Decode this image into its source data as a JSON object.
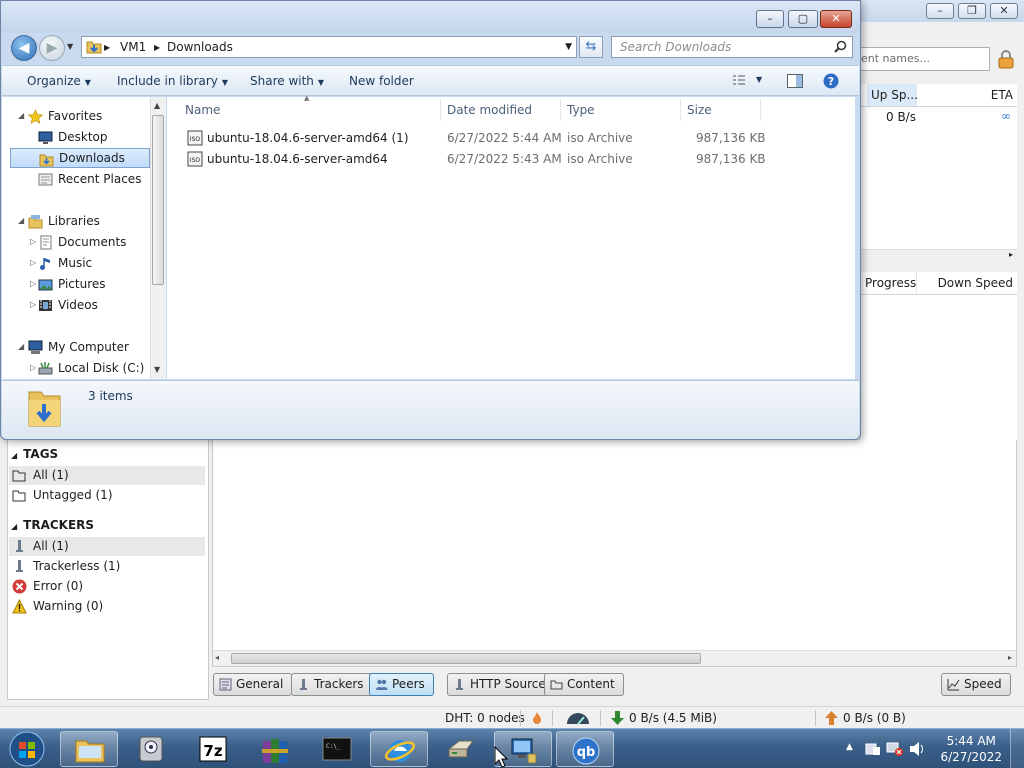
{
  "qbittorrent": {
    "search_placeholder": "ent names...",
    "torrent_columns": [
      "Up Sp...",
      "ETA"
    ],
    "torrent_row": {
      "up_speed": "0 B/s",
      "eta": "∞"
    },
    "peer_columns": [
      "Progress",
      "Down Speed"
    ],
    "sidebar": {
      "tags_title": "TAGS",
      "tags": [
        {
          "label": "All (1)",
          "icon": "folder-open-icon"
        },
        {
          "label": "Untagged (1)",
          "icon": "folder-open-icon"
        }
      ],
      "trackers_title": "TRACKERS",
      "trackers": [
        {
          "label": "All (1)",
          "icon": "tracker-icon"
        },
        {
          "label": "Trackerless (1)",
          "icon": "tracker-icon"
        },
        {
          "label": "Error (0)",
          "icon": "error-icon"
        },
        {
          "label": "Warning (0)",
          "icon": "warning-icon"
        }
      ]
    },
    "tabs": [
      {
        "label": "General",
        "icon": "info-icon"
      },
      {
        "label": "Trackers",
        "icon": "tracker-icon"
      },
      {
        "label": "Peers",
        "icon": "peers-icon"
      },
      {
        "label": "HTTP Sources",
        "icon": "server-icon"
      },
      {
        "label": "Content",
        "icon": "folder-icon"
      }
    ],
    "speed_button": "Speed",
    "status": {
      "dht": "DHT: 0 nodes",
      "down": "0 B/s (4.5 MiB)",
      "up": "0 B/s (0 B)"
    }
  },
  "explorer": {
    "breadcrumb": [
      "VM1",
      "Downloads"
    ],
    "search_placeholder": "Search Downloads",
    "toolbar": {
      "organize": "Organize",
      "include": "Include in library",
      "share": "Share with",
      "newfolder": "New folder"
    },
    "nav": {
      "favorites": "Favorites",
      "desktop": "Desktop",
      "downloads": "Downloads",
      "recent": "Recent Places",
      "libraries": "Libraries",
      "documents": "Documents",
      "music": "Music",
      "pictures": "Pictures",
      "videos": "Videos",
      "computer": "My Computer",
      "localdisk": "Local Disk (C:)"
    },
    "columns": {
      "name": "Name",
      "date": "Date modified",
      "type": "Type",
      "size": "Size"
    },
    "files": [
      {
        "name": "ubuntu-18.04.6-server-amd64 (1)",
        "date": "6/27/2022 5:44 AM",
        "type": "iso Archive",
        "size": "987,136 KB"
      },
      {
        "name": "ubuntu-18.04.6-server-amd64",
        "date": "6/27/2022 5:43 AM",
        "type": "iso Archive",
        "size": "987,136 KB"
      }
    ],
    "details": {
      "count": "3 items"
    }
  },
  "taskbar": {
    "apps": [
      "file-explorer-icon",
      "disk-utility-icon",
      "7zip-icon",
      "winrar-icon",
      "cmd-icon",
      "internet-explorer-icon",
      "drive-icon",
      "network-config-icon",
      "qbittorrent-icon"
    ],
    "clock_time": "5:44 AM",
    "clock_date": "6/27/2022"
  }
}
